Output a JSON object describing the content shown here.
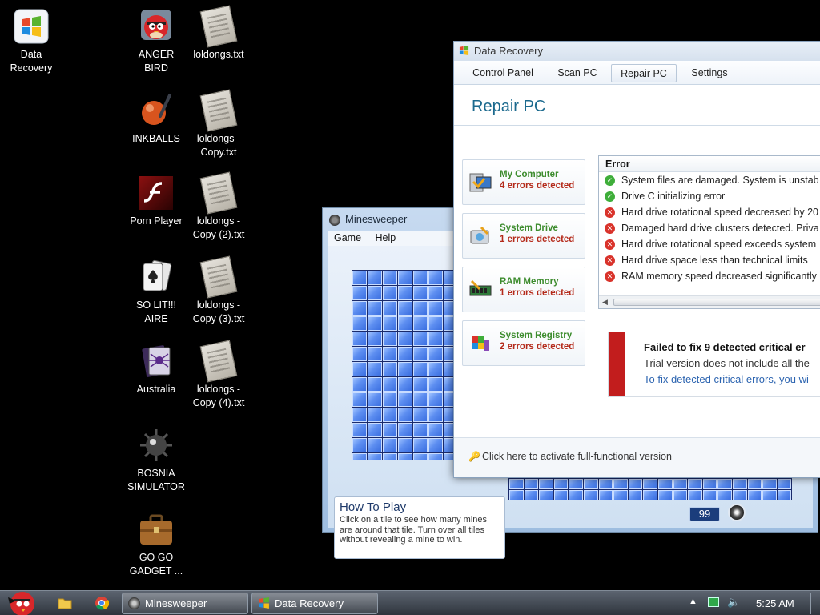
{
  "desktop": {
    "icons": [
      {
        "label": "Data\nRecovery",
        "icon": "windows-logo-icon"
      },
      {
        "label": "ANGER\nBIRD",
        "icon": "angry-bird-icon"
      },
      {
        "label": "loldongs.txt",
        "icon": "text-file-icon"
      },
      {
        "label": "INKBALLS",
        "icon": "inkball-icon"
      },
      {
        "label": "loldongs -\nCopy.txt",
        "icon": "text-file-icon"
      },
      {
        "label": "Porn Player",
        "icon": "flash-player-icon"
      },
      {
        "label": "loldongs -\nCopy (2).txt",
        "icon": "text-file-icon"
      },
      {
        "label": "SO LIT!!!\nAIRE",
        "icon": "playing-cards-icon"
      },
      {
        "label": "loldongs -\nCopy (3).txt",
        "icon": "text-file-icon"
      },
      {
        "label": "Australia",
        "icon": "spider-solitaire-icon"
      },
      {
        "label": "loldongs -\nCopy (4).txt",
        "icon": "text-file-icon"
      },
      {
        "label": "BOSNIA\nSIMULATOR",
        "icon": "mine-icon"
      },
      {
        "label": "GO GO\nGADGET ...",
        "icon": "briefcase-icon"
      }
    ]
  },
  "minesweeper": {
    "title": "Minesweeper",
    "menu": [
      "Game",
      "Help"
    ],
    "counter": "99",
    "howto_title": "How To Play",
    "howto_text": "Click on a tile to see how many mines are around that tile. Turn over all tiles without revealing a mine to win."
  },
  "data_recovery": {
    "title": "Data Recovery",
    "tabs": [
      "Control Panel",
      "Scan PC",
      "Repair PC",
      "Settings"
    ],
    "active_tab": "Repair PC",
    "heading": "Repair PC",
    "categories": [
      {
        "name": "My Computer",
        "errors": "4 errors detected"
      },
      {
        "name": "System Drive",
        "errors": "1 errors detected"
      },
      {
        "name": "RAM Memory",
        "errors": "1 errors detected"
      },
      {
        "name": "System Registry",
        "errors": "2 errors detected"
      }
    ],
    "error_header": "Error",
    "errors": [
      {
        "status": "ok",
        "text": "System files are damaged. System is unstab"
      },
      {
        "status": "ok",
        "text": "Drive C initializing error"
      },
      {
        "status": "bad",
        "text": "Hard drive rotational speed decreased by 20"
      },
      {
        "status": "bad",
        "text": "Damaged hard drive clusters detected. Priva"
      },
      {
        "status": "bad",
        "text": "Hard drive rotational speed exceeds system"
      },
      {
        "status": "bad",
        "text": "Hard drive space less than technical limits"
      },
      {
        "status": "bad",
        "text": "RAM memory speed decreased significantly"
      }
    ],
    "fail_title": "Failed to fix 9 detected critical er",
    "fail_line2": "Trial version does not include all the",
    "fail_line3": "To fix detected critical errors, you wi",
    "footer_text": "Click here to activate full-functional version"
  },
  "taskbar": {
    "buttons": [
      "Minesweeper",
      "Data Recovery"
    ],
    "clock": "5:25 AM"
  },
  "colors": {
    "accent": "#1c6a8e",
    "error_red": "#b42a1a",
    "ok_green": "#3d8c2e",
    "tile_blue": "#3a6ee0"
  }
}
